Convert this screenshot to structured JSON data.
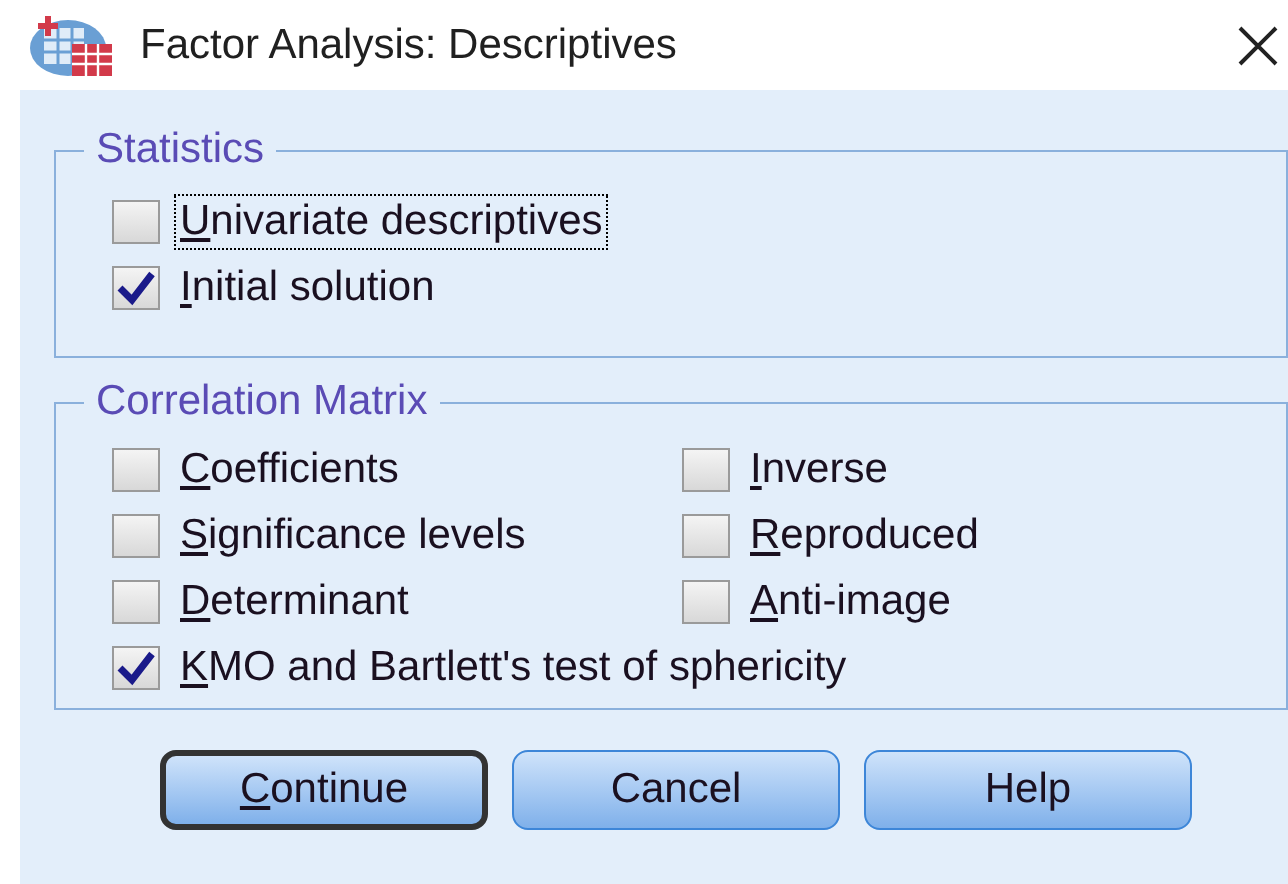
{
  "window": {
    "title": "Factor Analysis: Descriptives"
  },
  "statistics": {
    "title": "Statistics",
    "items": [
      {
        "label": "Univariate descriptives",
        "checked": false,
        "focused": true,
        "mnemonic": true
      },
      {
        "label": "Initial solution",
        "checked": true,
        "focused": false,
        "mnemonic": true
      }
    ]
  },
  "correlation_matrix": {
    "title": "Correlation Matrix",
    "items": [
      {
        "label": "Coefficients",
        "checked": false,
        "mnemonic": true
      },
      {
        "label": "Inverse",
        "checked": false,
        "mnemonic": true
      },
      {
        "label": "Significance levels",
        "checked": false,
        "mnemonic": true
      },
      {
        "label": "Reproduced",
        "checked": false,
        "mnemonic": true
      },
      {
        "label": "Determinant",
        "checked": false,
        "mnemonic": true
      },
      {
        "label": "Anti-image",
        "checked": false,
        "mnemonic": true
      }
    ],
    "wide_item": {
      "label": "KMO and Bartlett's test of sphericity",
      "checked": true,
      "mnemonic": true
    }
  },
  "buttons": [
    {
      "label": "Continue",
      "default": true,
      "mnemonic": true
    },
    {
      "label": "Cancel",
      "default": false,
      "mnemonic": false
    },
    {
      "label": "Help",
      "default": false,
      "mnemonic": false
    }
  ]
}
